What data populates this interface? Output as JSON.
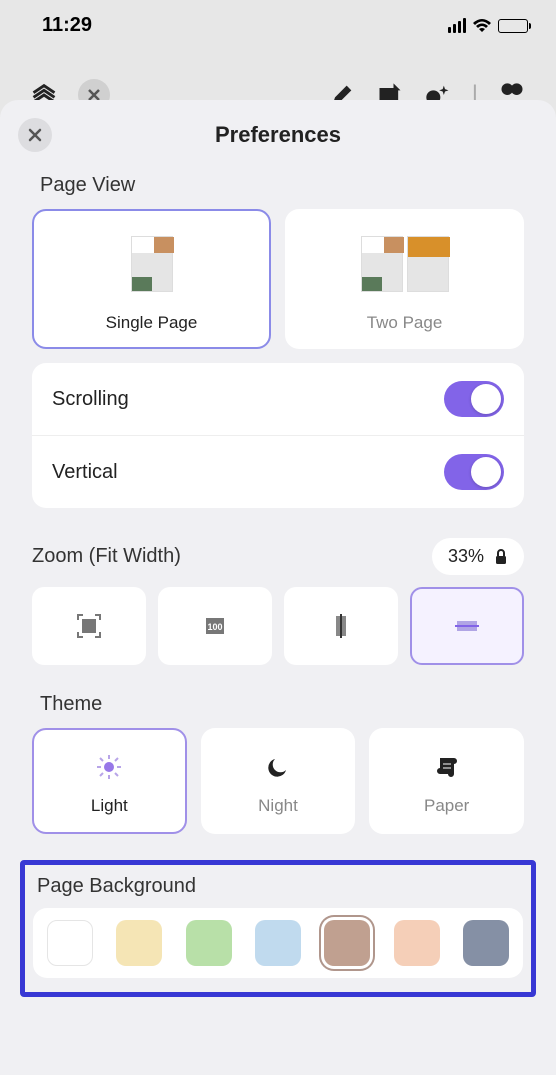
{
  "status": {
    "time": "11:29"
  },
  "sheet": {
    "title": "Preferences"
  },
  "pageView": {
    "label": "Page View",
    "single": "Single Page",
    "two": "Two Page"
  },
  "toggles": {
    "scrolling": "Scrolling",
    "vertical": "Vertical"
  },
  "zoom": {
    "label": "Zoom (Fit Width)",
    "value": "33%"
  },
  "theme": {
    "label": "Theme",
    "light": "Light",
    "night": "Night",
    "paper": "Paper"
  },
  "background": {
    "label": "Page Background",
    "swatches": [
      "#ffffff",
      "#f5e5b5",
      "#b8e0a8",
      "#c0daee",
      "#c0a090",
      "#f5cfb8",
      "#8590a5"
    ]
  }
}
